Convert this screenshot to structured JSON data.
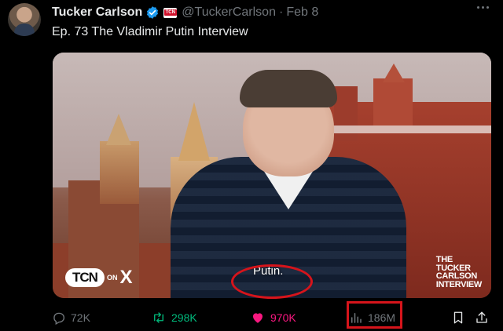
{
  "author": {
    "display_name": "Tucker Carlson",
    "handle": "@TuckerCarlson",
    "separator": "·",
    "date": "Feb 8",
    "verified_icon": "verified-badge-icon",
    "affiliation_icon": "tcn-affiliation-badge-icon",
    "affiliation_text": "TCN"
  },
  "tweet": {
    "text": "Ep. 73  The Vladimir Putin Interview"
  },
  "media": {
    "caption": "Putin.",
    "logo_left": {
      "tcn": "TCN",
      "on": "ON",
      "x": "X"
    },
    "watermark": [
      "THE",
      "TUCKER",
      "CARLSON",
      "INTERVIEW"
    ]
  },
  "actions": {
    "replies": "72K",
    "reposts": "298K",
    "likes": "970K",
    "views": "186M"
  },
  "colors": {
    "background": "#000000",
    "text_primary": "#e7e9ea",
    "text_secondary": "#71767b",
    "verified_blue": "#1d9bf0",
    "repost_green": "#00ba7c",
    "like_pink": "#f91880",
    "annotation_red": "#d6141b"
  }
}
